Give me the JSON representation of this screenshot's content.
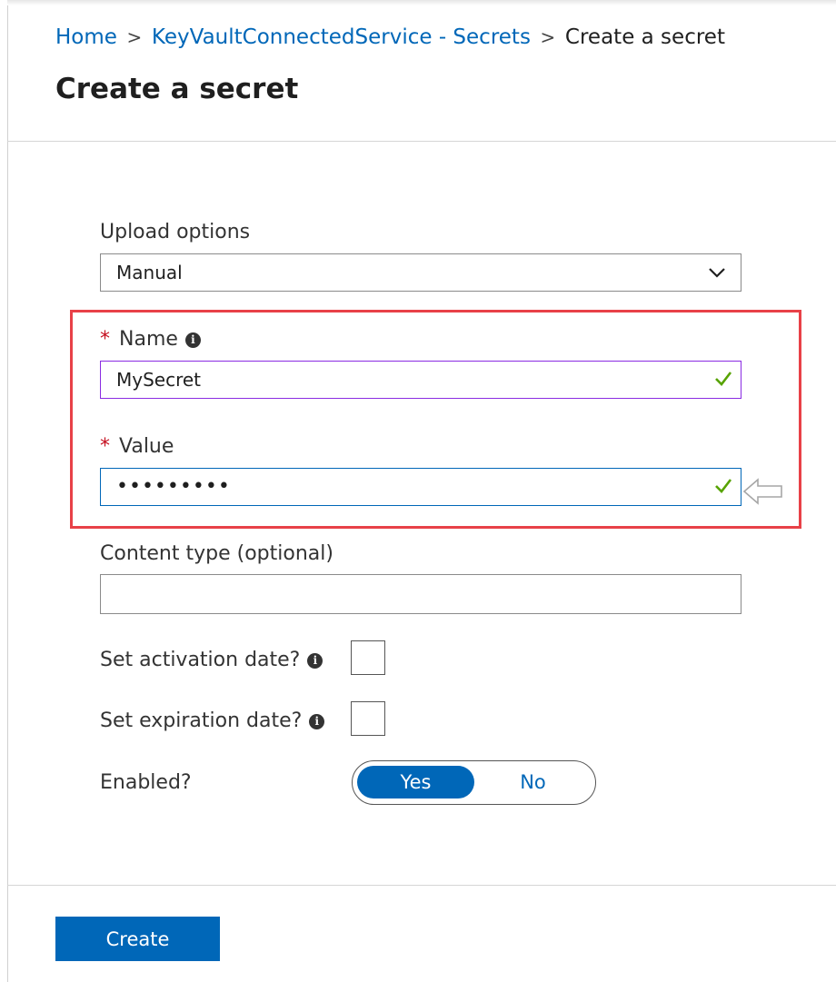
{
  "breadcrumb": {
    "home": "Home",
    "parent": "KeyVaultConnectedService - Secrets",
    "current": "Create a secret",
    "separator": ">"
  },
  "page_title": "Create a secret",
  "upload_options": {
    "label": "Upload options",
    "selected": "Manual",
    "icon": "chevron-down-icon"
  },
  "name_field": {
    "required_marker": "*",
    "label": "Name",
    "info_icon": "i",
    "value": "MySecret",
    "valid_icon": "checkmark-icon"
  },
  "value_field": {
    "required_marker": "*",
    "label": "Value",
    "value": "•••••••••",
    "valid_icon": "checkmark-icon"
  },
  "content_type": {
    "label": "Content type (optional)",
    "value": ""
  },
  "activation_date": {
    "label": "Set activation date?",
    "info_icon": "i",
    "checked": false
  },
  "expiration_date": {
    "label": "Set expiration date?",
    "info_icon": "i",
    "checked": false
  },
  "enabled": {
    "label": "Enabled?",
    "yes": "Yes",
    "no": "No",
    "selected": "Yes"
  },
  "footer": {
    "create_label": "Create"
  },
  "colors": {
    "accent": "#0067b8",
    "highlight_border": "#e84148",
    "name_border": "#8a2be2",
    "check_green": "#57a300",
    "required": "#c50f1f"
  }
}
